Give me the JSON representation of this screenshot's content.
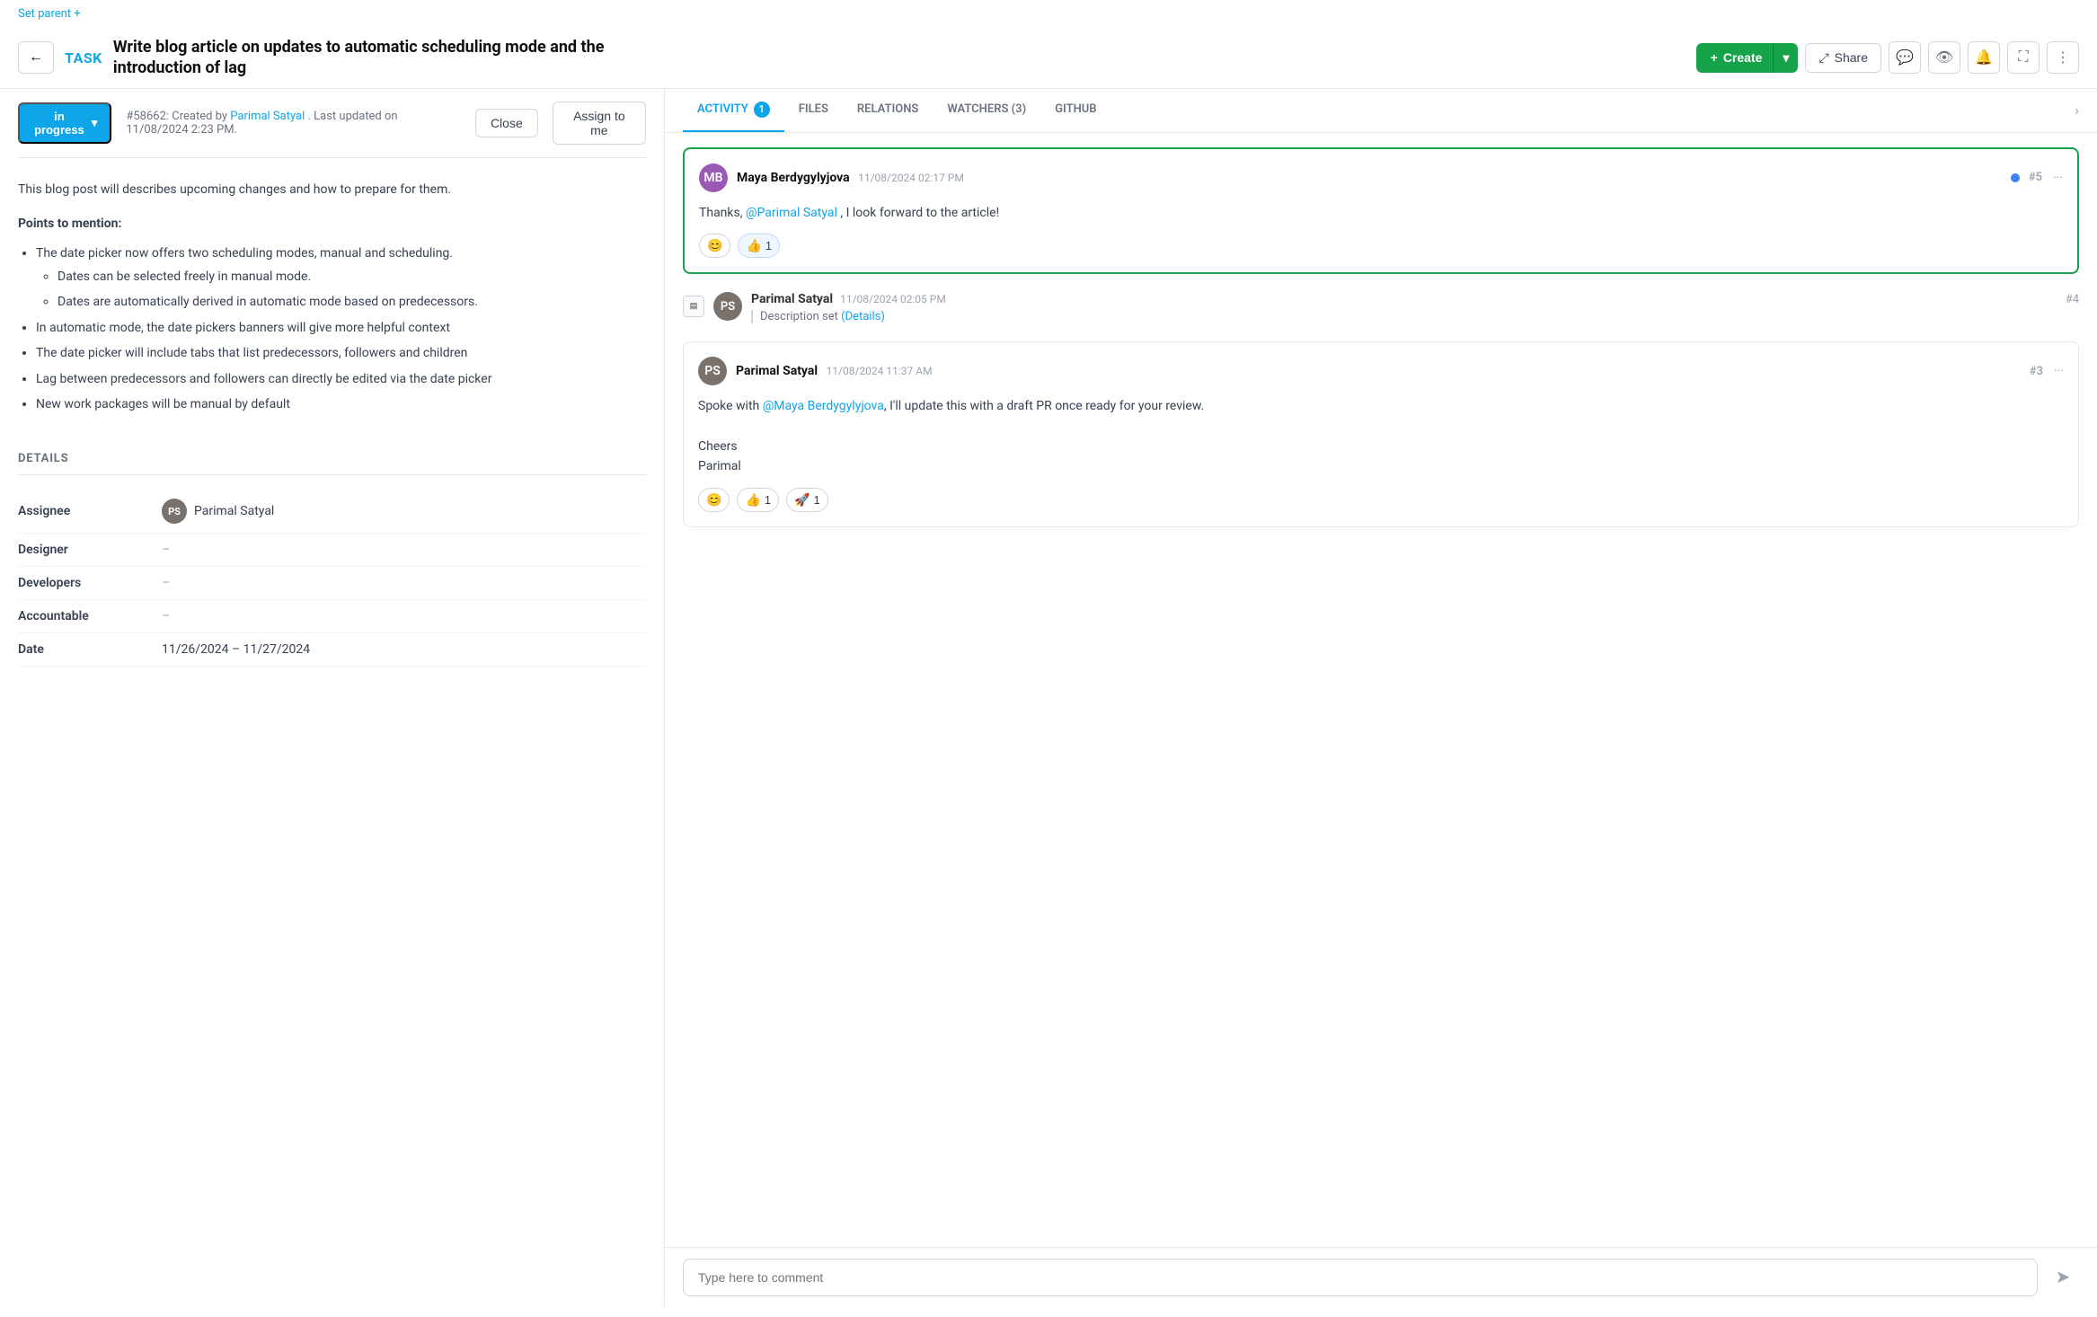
{
  "setParent": "Set parent +",
  "header": {
    "backBtn": "←",
    "taskLabel": "TASK",
    "taskTitle": "Write blog article on updates to automatic scheduling mode and the introduction of lag",
    "createBtn": "Create",
    "shareBtn": "Share"
  },
  "toolbar": {
    "icons": [
      "💬",
      "👁",
      "🔔",
      "⛶",
      "⋮"
    ]
  },
  "statusBar": {
    "status": "in progress",
    "taskId": "#58662:",
    "createdBy": "Created by",
    "author": "Parimal Satyal",
    "lastUpdated": ". Last updated on 11/08/2024 2:23 PM.",
    "closeBtn": "Close",
    "assignBtn": "Assign to me"
  },
  "description": {
    "intro": "This blog post will describes upcoming changes and how to prepare for them.",
    "pointsHeader": "Points to mention:",
    "bullets": [
      "The date picker now offers two scheduling modes, manual and scheduling.",
      "In automatic mode, the date pickers banners will give more helpful context",
      "The date picker will include tabs that list predecessors, followers and children",
      "Lag between predecessors and followers can directly be edited via the date picker",
      "New work packages will be manual by default"
    ],
    "subBullets": [
      "Dates can be selected freely in manual mode.",
      "Dates are automatically derived in automatic mode based on predecessors."
    ]
  },
  "details": {
    "sectionTitle": "DETAILS",
    "fields": [
      {
        "label": "Assignee",
        "value": "Parimal Satyal",
        "hasAvatar": true
      },
      {
        "label": "Designer",
        "value": "–",
        "hasAvatar": false
      },
      {
        "label": "Developers",
        "value": "–",
        "hasAvatar": false
      },
      {
        "label": "Accountable",
        "value": "–",
        "hasAvatar": false
      },
      {
        "label": "Date",
        "value": "11/26/2024 – 11/27/2024",
        "hasAvatar": false
      }
    ]
  },
  "tabs": [
    {
      "label": "ACTIVITY",
      "badge": "1",
      "active": true
    },
    {
      "label": "FILES",
      "badge": null,
      "active": false
    },
    {
      "label": "RELATIONS",
      "badge": null,
      "active": false
    },
    {
      "label": "WATCHERS (3)",
      "badge": null,
      "active": false
    },
    {
      "label": "GITHUB",
      "badge": null,
      "active": false
    }
  ],
  "activity": {
    "comments": [
      {
        "id": "c1",
        "author": "Maya Berdygylyjova",
        "initials": "MB",
        "avatarColor": "#9b59b6",
        "time": "11/08/2024 02:17 PM",
        "number": "#5",
        "hasDot": true,
        "highlighted": true,
        "body": "Thanks, @Parimal Satyal , I look forward to the article!",
        "reactions": [
          {
            "emoji": "😊",
            "count": null,
            "reacted": false
          },
          {
            "emoji": "👍",
            "count": "1",
            "reacted": true
          }
        ]
      }
    ],
    "systemEvents": [
      {
        "id": "e1",
        "author": "Parimal Satyal",
        "initials": "PS",
        "avatarColor": "#78716c",
        "time": "11/08/2024 02:05 PM",
        "number": "#4",
        "description": "Description set",
        "link": "(Details)"
      }
    ],
    "comments2": [
      {
        "id": "c2",
        "author": "Parimal Satyal",
        "initials": "PS",
        "avatarColor": "#78716c",
        "time": "11/08/2024 11:37 AM",
        "number": "#3",
        "highlighted": false,
        "body": "Spoke with @Maya Berdygylyjova, I'll update this with a draft PR once ready for your review.\n\nCheers\nParimal",
        "reactions": [
          {
            "emoji": "😊",
            "count": null,
            "reacted": false
          },
          {
            "emoji": "👍",
            "count": "1",
            "reacted": false
          },
          {
            "emoji": "🚀",
            "count": "1",
            "reacted": false
          }
        ]
      }
    ]
  },
  "commentInput": {
    "placeholder": "Type here to comment"
  }
}
